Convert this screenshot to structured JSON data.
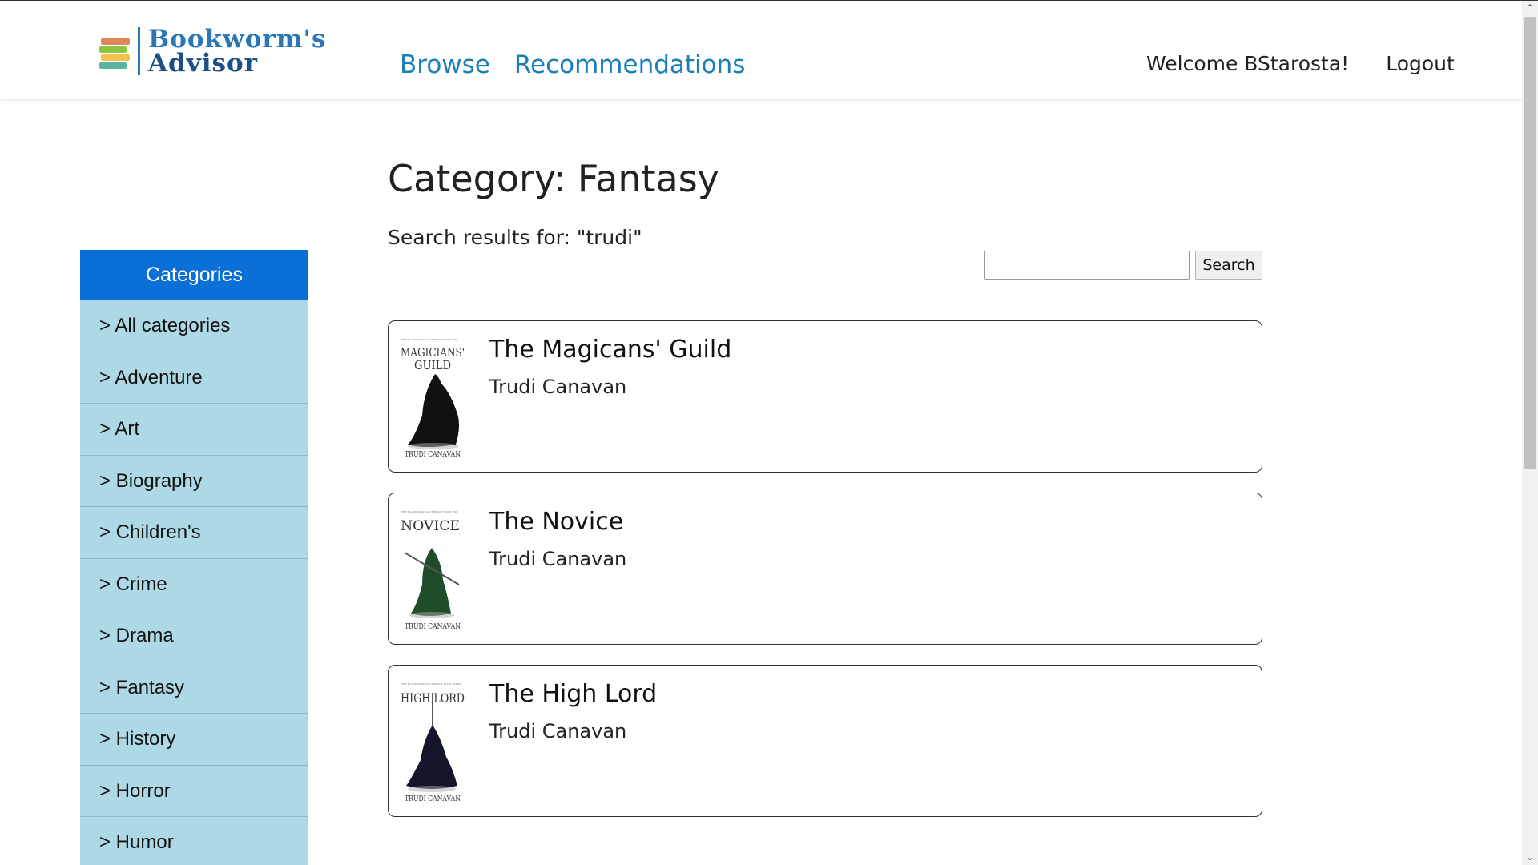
{
  "header": {
    "logo_line1": "Bookworm's",
    "logo_line2": "Advisor",
    "nav": [
      {
        "label": "Browse"
      },
      {
        "label": "Recommendations"
      }
    ],
    "welcome": "Welcome BStarosta!",
    "logout": "Logout"
  },
  "colors": {
    "brand_blue": "#2a77b8",
    "nav_link": "#1a7fb5",
    "sidebar_header": "#0b6fd8",
    "sidebar_item": "#add8e6"
  },
  "sidebar": {
    "title": "Categories",
    "items": [
      {
        "label": "> All categories"
      },
      {
        "label": "> Adventure"
      },
      {
        "label": "> Art"
      },
      {
        "label": "> Biography"
      },
      {
        "label": "> Children's"
      },
      {
        "label": "> Crime"
      },
      {
        "label": "> Drama"
      },
      {
        "label": "> Fantasy"
      },
      {
        "label": "> History"
      },
      {
        "label": "> Horror"
      },
      {
        "label": "> Humor"
      }
    ]
  },
  "main": {
    "title": "Category: Fantasy",
    "search_caption": "Search results for: \"trudi\"",
    "search": {
      "value": "",
      "placeholder": "",
      "button_label": "Search"
    },
    "books": [
      {
        "title": "The Magicans' Guild",
        "author": "Trudi Canavan",
        "cover": {
          "series": "THE BLACK MAGICIAN TRILOGY BOOK ONE",
          "line1": "MAGICIANS'",
          "line2": "GUILD",
          "author": "TRUDI CANAVAN",
          "robe": "#111111"
        }
      },
      {
        "title": "The Novice",
        "author": "Trudi Canavan",
        "cover": {
          "series": "THE BLACK MAGICIAN TRILOGY BOOK TWO",
          "line1": "NOVICE",
          "line2": "",
          "author": "TRUDI CANAVAN",
          "robe": "#1f4d2a"
        }
      },
      {
        "title": "The High Lord",
        "author": "Trudi Canavan",
        "cover": {
          "series": "THE BLACK MAGICIAN TRILOGY BOOK THREE",
          "line1": "HIGH LORD",
          "line2": "",
          "author": "TRUDI CANAVAN",
          "robe": "#14142a"
        }
      }
    ]
  }
}
